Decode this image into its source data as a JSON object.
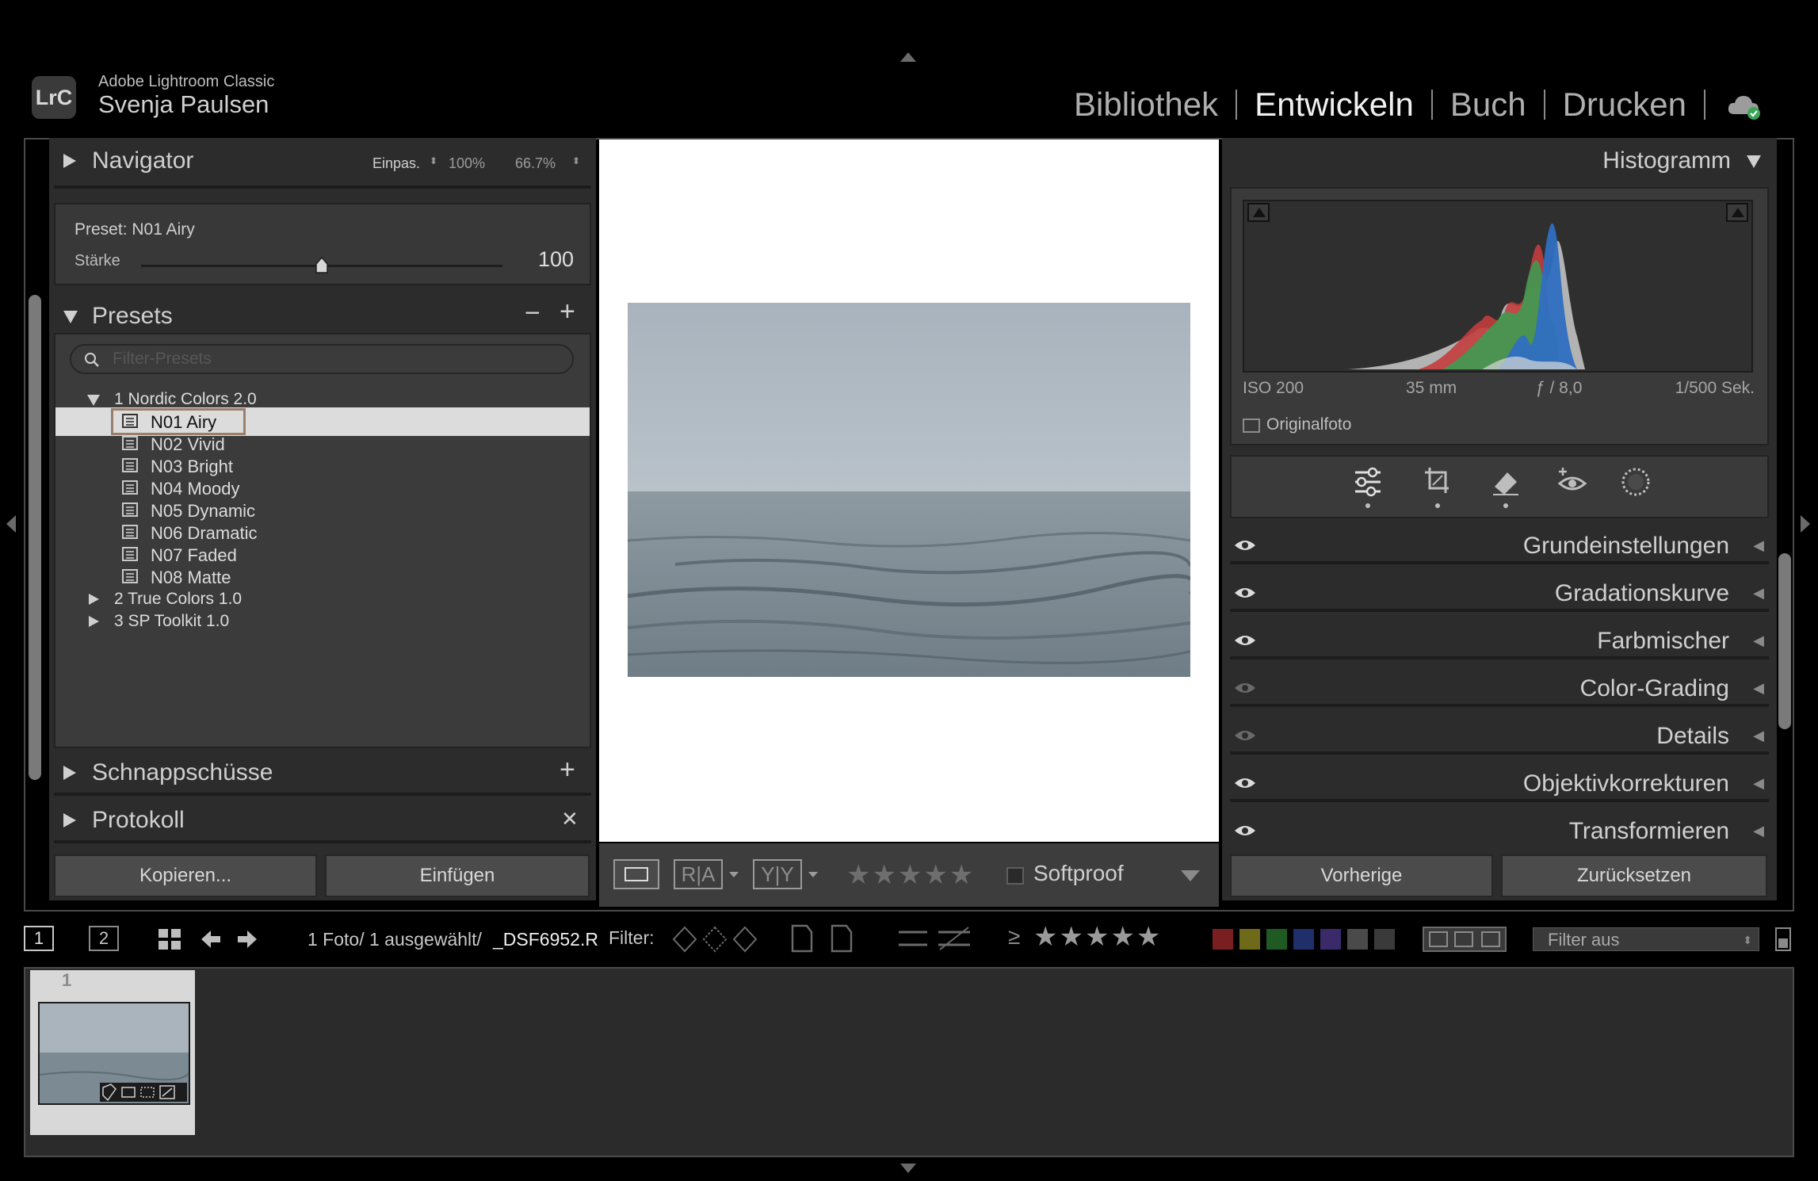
{
  "app": {
    "logo": "LrC",
    "product": "Adobe Lightroom Classic",
    "user": "Svenja Paulsen"
  },
  "modules": [
    {
      "label": "Bibliothek",
      "active": false
    },
    {
      "label": "Entwickeln",
      "active": true
    },
    {
      "label": "Buch",
      "active": false
    },
    {
      "label": "Drucken",
      "active": false
    }
  ],
  "left": {
    "navigator": {
      "title": "Navigator",
      "fit": "Einpas.",
      "zoom1": "100%",
      "zoom2": "66.7%"
    },
    "preset_amount": {
      "label": "Preset: N01  Airy",
      "slider_label": "Stärke",
      "value": "100",
      "level": 0.5
    },
    "presets": {
      "title": "Presets",
      "minus": "−",
      "plus": "+",
      "search_placeholder": "Filter-Presets",
      "groups": [
        {
          "label": "1  Nordic Colors 2.0",
          "expanded": true
        },
        {
          "label": "2  True Colors 1.0",
          "expanded": false
        },
        {
          "label": "3  SP Toolkit 1.0",
          "expanded": false
        }
      ],
      "items": [
        "N01  Airy",
        "N02  Vivid",
        "N03  Bright",
        "N04  Moody",
        "N05  Dynamic",
        "N06  Dramatic",
        "N07  Faded",
        "N08  Matte"
      ],
      "selected": "N01  Airy"
    },
    "snapshots": {
      "title": "Schnappschüsse",
      "action": "+"
    },
    "history": {
      "title": "Protokoll",
      "action": "✕"
    },
    "copy_button": "Kopieren...",
    "paste_button": "Einfügen"
  },
  "toolbar": {
    "ra_label": "R|A",
    "yy_label": "Y|Y",
    "stars": "★★★★★",
    "softproof": "Softproof"
  },
  "right": {
    "histogram": {
      "title": "Histogramm",
      "iso": "ISO 200",
      "focal": "35 mm",
      "aperture": "ƒ / 8,0",
      "shutter": "1/500 Sek.",
      "original_label": "Originalfoto"
    },
    "tools": [
      "sliders-icon",
      "crop-icon",
      "eraser-icon",
      "redeye-icon",
      "mask-icon"
    ],
    "sections": [
      {
        "name": "Grundeinstellungen",
        "enabled": true
      },
      {
        "name": "Gradationskurve",
        "enabled": true
      },
      {
        "name": "Farbmischer",
        "enabled": true
      },
      {
        "name": "Color-Grading",
        "enabled": false
      },
      {
        "name": "Details",
        "enabled": false
      },
      {
        "name": "Objektivkorrekturen",
        "enabled": true
      },
      {
        "name": "Transformieren",
        "enabled": true
      }
    ],
    "prev_button": "Vorherige",
    "reset_button": "Zurücksetzen"
  },
  "filmbar": {
    "screen1": "1",
    "screen2": "2",
    "info_prefix": "1 Foto/ 1 ausgewählt/",
    "filename": "_DSF6952.R",
    "filter_label": "Filter:",
    "gte": "≥",
    "stars": "★★★★★",
    "filter_value": "Filter aus",
    "color_labels": [
      "#7a1f1f",
      "#6f6a1a",
      "#1f5a22",
      "#1f2f6a",
      "#3a2a6a",
      "#4a4a4a",
      "#3a3a3a"
    ]
  },
  "filmstrip": {
    "index": "1"
  }
}
